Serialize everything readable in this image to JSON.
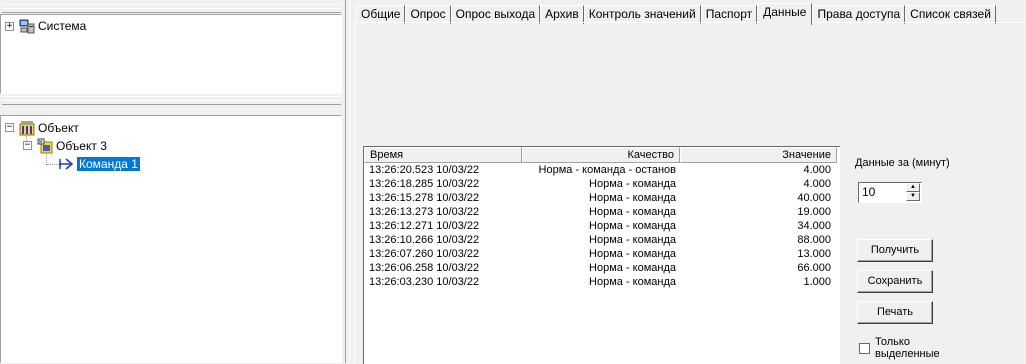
{
  "tree_top": {
    "items": [
      {
        "label": "Система",
        "expander": "+",
        "icon": "computer-network-icon"
      }
    ]
  },
  "tree_bottom": {
    "items": [
      {
        "label": "Объект",
        "expander": "−",
        "icon": "object-building-icon"
      },
      {
        "label": "Объект 3",
        "expander": "−",
        "icon": "object-folder-icon"
      },
      {
        "label": "Команда 1",
        "icon": "command-arrow-icon",
        "selected": true
      }
    ]
  },
  "tabs": [
    {
      "label": "Общие"
    },
    {
      "label": "Опрос"
    },
    {
      "label": "Опрос выхода"
    },
    {
      "label": "Архив"
    },
    {
      "label": "Контроль значений"
    },
    {
      "label": "Паспорт"
    },
    {
      "label": "Данные",
      "active": true
    },
    {
      "label": "Права доступа"
    },
    {
      "label": "Список связей"
    }
  ],
  "grid": {
    "columns": [
      "Время",
      "Качество",
      "Значение"
    ],
    "rows": [
      [
        "13:26:20.523 10/03/22",
        "Норма - команда - останов",
        "4.000"
      ],
      [
        "13:26:18.285 10/03/22",
        "Норма - команда",
        "4.000"
      ],
      [
        "13:26:15.278 10/03/22",
        "Норма - команда",
        "40.000"
      ],
      [
        "13:26:13.273 10/03/22",
        "Норма - команда",
        "19.000"
      ],
      [
        "13:26:12.271 10/03/22",
        "Норма - команда",
        "34.000"
      ],
      [
        "13:26:10.266 10/03/22",
        "Норма - команда",
        "88.000"
      ],
      [
        "13:26:07.260 10/03/22",
        "Норма - команда",
        "13.000"
      ],
      [
        "13:26:06.258 10/03/22",
        "Норма - команда",
        "66.000"
      ],
      [
        "13:26:03.230 10/03/22",
        "Норма - команда",
        "1.000"
      ]
    ]
  },
  "controls": {
    "period_label": "Данные за (минут)",
    "period_value": "10",
    "get_label": "Получить",
    "save_label": "Сохранить",
    "print_label": "Печать",
    "only_selected_label": "Только выделенные",
    "only_selected_checked": false
  },
  "colors": {
    "selection": "#0078d7",
    "background": "#f0f0f0"
  }
}
